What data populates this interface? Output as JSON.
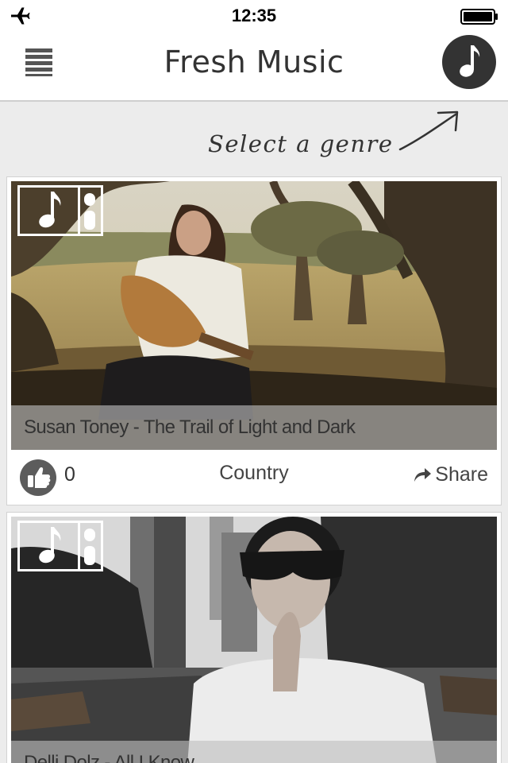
{
  "status_bar": {
    "time": "12:35",
    "airplane_icon": "airplane-icon",
    "battery_icon": "battery-icon"
  },
  "nav": {
    "title": "Fresh Music",
    "menu_icon": "hamburger-menu-icon",
    "genre_icon": "music-note-icon"
  },
  "hint": {
    "text": "Select a genre",
    "arrow_icon": "hand-drawn-arrow-icon"
  },
  "feed": [
    {
      "caption": "Susan Toney - The Trail of Light and Dark",
      "likes": "0",
      "genre": "Country",
      "share_label": "Share",
      "badge_icon": "music-video-icon"
    },
    {
      "caption": "Delli Dolz - All I Know",
      "badge_icon": "music-video-icon"
    }
  ],
  "colors": {
    "background": "#ececec",
    "card": "#ffffff",
    "dark_accent": "#333333",
    "caption_overlay": "#bebebe"
  }
}
